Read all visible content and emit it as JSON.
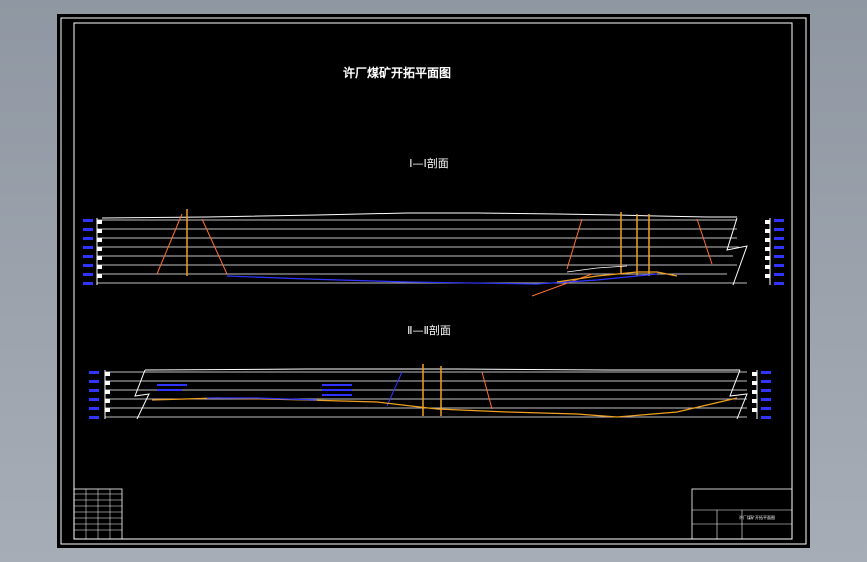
{
  "drawing": {
    "title": "许厂煤矿开拓平面图",
    "section1_label": "Ⅰ—Ⅰ剖面",
    "section2_label": "Ⅱ—Ⅱ剖面",
    "title_block_name": "许厂煤矿开拓平面图"
  },
  "colors": {
    "viewer_background": "#9aa1ab",
    "sheet_background": "#000000",
    "frame": "#ffffff",
    "coal_seam": "#f0a020",
    "surface_line": "#ffffff",
    "elevation_labels": "#2f35ff",
    "fault_lines": "#ff7030",
    "shaft": "#f0a020"
  }
}
